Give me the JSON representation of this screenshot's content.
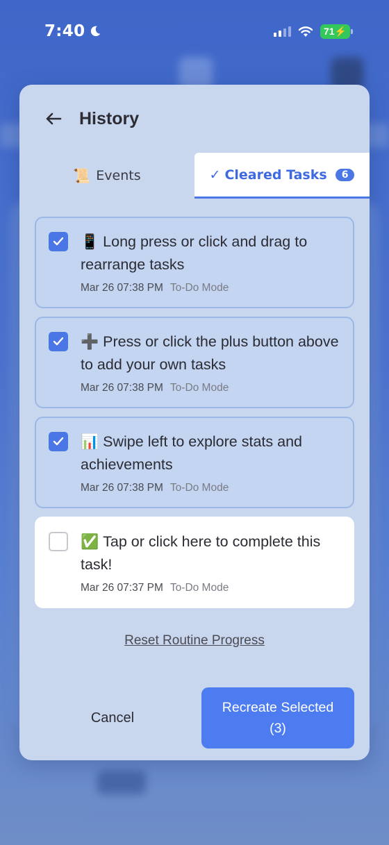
{
  "status_bar": {
    "time": "7:40",
    "battery": "71"
  },
  "modal": {
    "title": "History",
    "tabs": [
      {
        "label": "Events",
        "icon": "scroll-icon"
      },
      {
        "label": "Cleared Tasks",
        "icon": "check-icon",
        "badge": "6",
        "active": true
      }
    ],
    "tasks": [
      {
        "emoji": "📱",
        "text": "Long press or click and drag to rearrange tasks",
        "date": "Mar 26 07:38 PM",
        "mode": "To-Do Mode",
        "checked": true
      },
      {
        "emoji": "➕",
        "text": "Press or click the plus button above to add your own tasks",
        "date": "Mar 26 07:38 PM",
        "mode": "To-Do Mode",
        "checked": true
      },
      {
        "emoji": "📊",
        "text": "Swipe left to explore stats and achievements",
        "date": "Mar 26 07:38 PM",
        "mode": "To-Do Mode",
        "checked": true
      },
      {
        "emoji": "✅",
        "text": "Tap or click here to complete this task!",
        "date": "Mar 26 07:37 PM",
        "mode": "To-Do Mode",
        "checked": false
      }
    ],
    "reset_label": "Reset Routine Progress",
    "cancel_label": "Cancel",
    "recreate_label_line1": "Recreate Selected",
    "recreate_label_line2": "(3)"
  },
  "colors": {
    "accent": "#4a76e6",
    "battery": "#34c759",
    "selected_row": "#c3d5f1"
  }
}
